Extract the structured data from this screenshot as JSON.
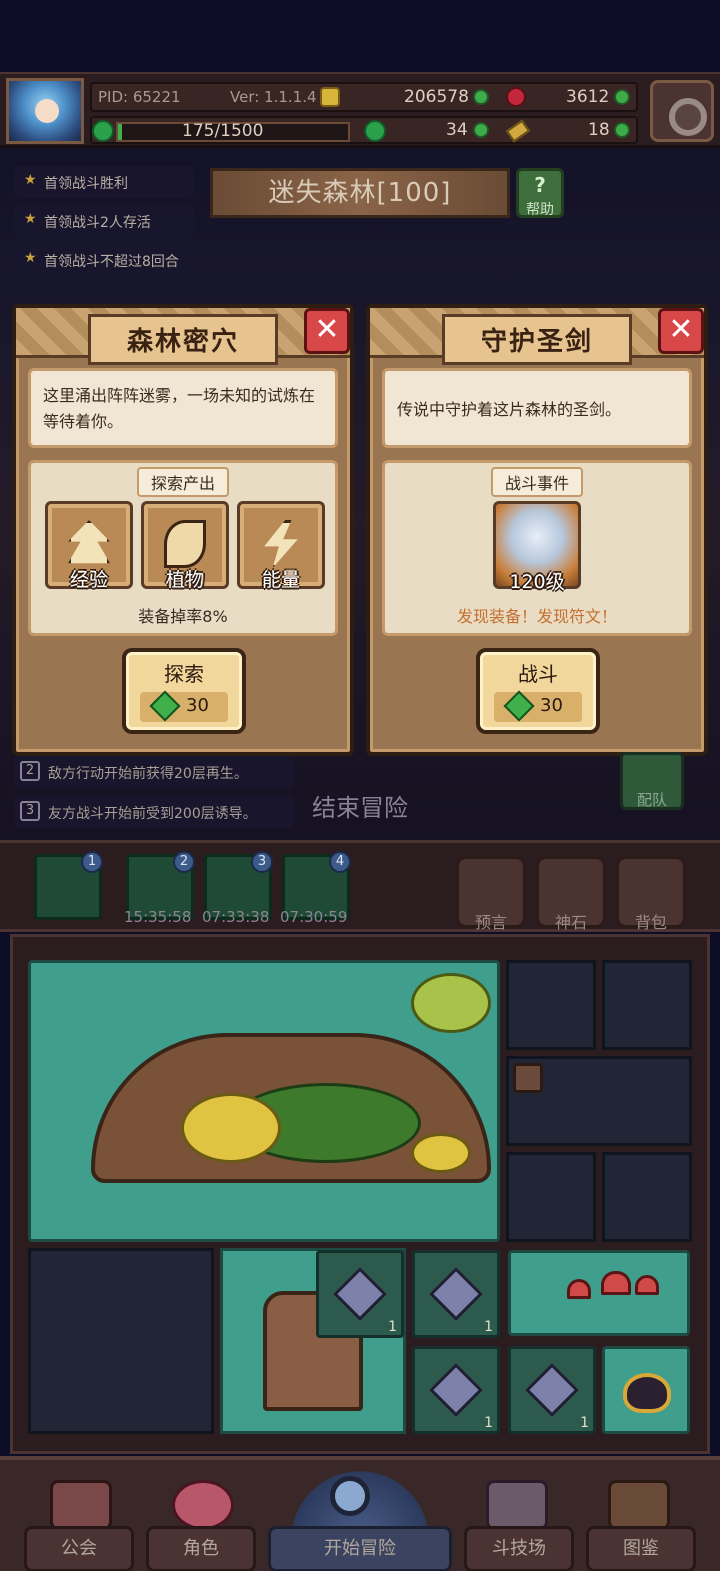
{
  "header": {
    "pid": "PID: 65221",
    "version": "Ver: 1.1.1.4",
    "gold": "206578",
    "red_currency": "3612",
    "exp": "175/1500",
    "clover": "34",
    "keys": "18"
  },
  "quests": [
    "首领战斗胜利",
    "首领战斗2人存活",
    "首领战斗不超过8回合"
  ],
  "stage": {
    "title": "迷失森林[100]",
    "help_label": "帮助",
    "help_glyph": "?"
  },
  "card_left": {
    "title": "森林密穴",
    "close_glyph": "✕",
    "description": "这里涌出阵阵迷雾，一场未知的试炼在等待着你。",
    "section_label": "探索产出",
    "rewards": [
      "经验",
      "植物",
      "能量"
    ],
    "drop_rate": "装备掉率8%",
    "action_label": "探索",
    "action_cost": "30"
  },
  "card_right": {
    "title": "守护圣剑",
    "close_glyph": "✕",
    "description": "传说中守护着这片森林的圣剑。",
    "section_label": "战斗事件",
    "enemy_level": "120级",
    "notice": "发现装备！发现符文！",
    "action_label": "战斗",
    "action_cost": "30"
  },
  "rules": [
    {
      "num": "2",
      "text": "敌方行动开始前获得20层再生。"
    },
    {
      "num": "3",
      "text": "友方战斗开始前受到200层诱导。"
    }
  ],
  "end_adventure": "结束冒险",
  "team_label": "配队",
  "minimap": {
    "slots": [
      "1",
      "2",
      "3",
      "4"
    ],
    "timers": [
      "15:35:58",
      "07:33:38",
      "07:30:59"
    ]
  },
  "side_buttons": [
    "预言",
    "神石",
    "背包"
  ],
  "tiles": {
    "gem_counts": [
      "1",
      "1",
      "1",
      "1"
    ]
  },
  "nav": [
    "公会",
    "角色",
    "开始冒险",
    "斗技场",
    "图鉴"
  ],
  "colors": {
    "background": "#0e0d27",
    "card": "#9a7552",
    "close": "#d84848",
    "accent_green": "#3fb04a",
    "warning_text": "#c4702e",
    "forest_tile": "#3f9f8c"
  }
}
